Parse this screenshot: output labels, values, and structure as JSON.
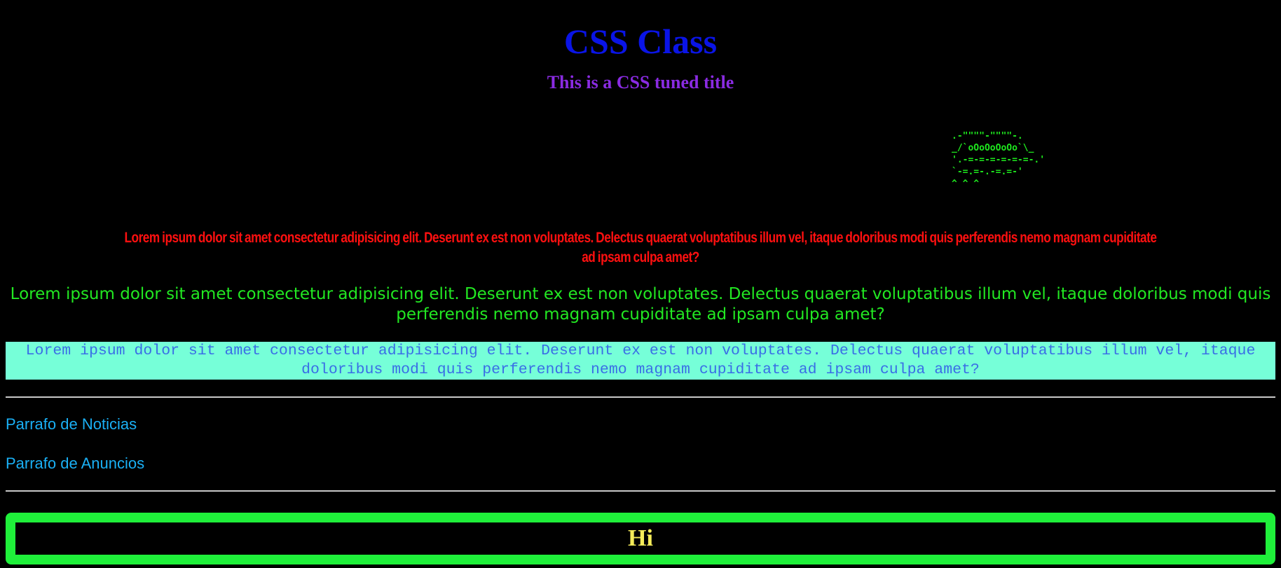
{
  "header": {
    "title": "CSS Class",
    "subtitle": "This is a CSS tuned title"
  },
  "ascii_art": ".-\"\"\"\"-\"\"\"\"-.\n_/`oOoOoOoOo`\\_\n'.-=-=-=-=-=-=-.'\n`-=.=-.-=.=-'\n^ ^ ^",
  "paragraphs": {
    "red": "Lorem ipsum dolor sit amet consectetur adipisicing elit. Deserunt ex est non voluptates. Delectus quaerat voluptatibus illum vel, itaque doloribus modi quis perferendis nemo magnam cupiditate ad ipsam culpa amet?",
    "green": "Lorem ipsum dolor sit amet consectetur adipisicing elit. Deserunt ex est non voluptates. Delectus quaerat voluptatibus illum vel, itaque doloribus modi quis perferendis nemo magnam cupiditate ad ipsam culpa amet?",
    "mono": "Lorem ipsum dolor sit amet consectetur adipisicing elit. Deserunt ex est non voluptates. Delectus quaerat voluptatibus illum vel, itaque doloribus modi quis perferendis nemo magnam cupiditate ad ipsam culpa amet?"
  },
  "sections": {
    "news": "Parrafo de Noticias",
    "ads": "Parrafo de Anuncios"
  },
  "box": {
    "text": "Hi"
  },
  "colors": {
    "background": "#000000",
    "title": "#0a14e6",
    "subtitle": "#8a2be2",
    "ascii": "#1ee81e",
    "red_paragraph": "#ff1010",
    "green_paragraph": "#22e822",
    "mono_background": "#76ffd8",
    "mono_text": "#3a6ee6",
    "links": "#1ab0f5",
    "box_border": "#1ff03a",
    "box_text": "#f5ec5a"
  }
}
